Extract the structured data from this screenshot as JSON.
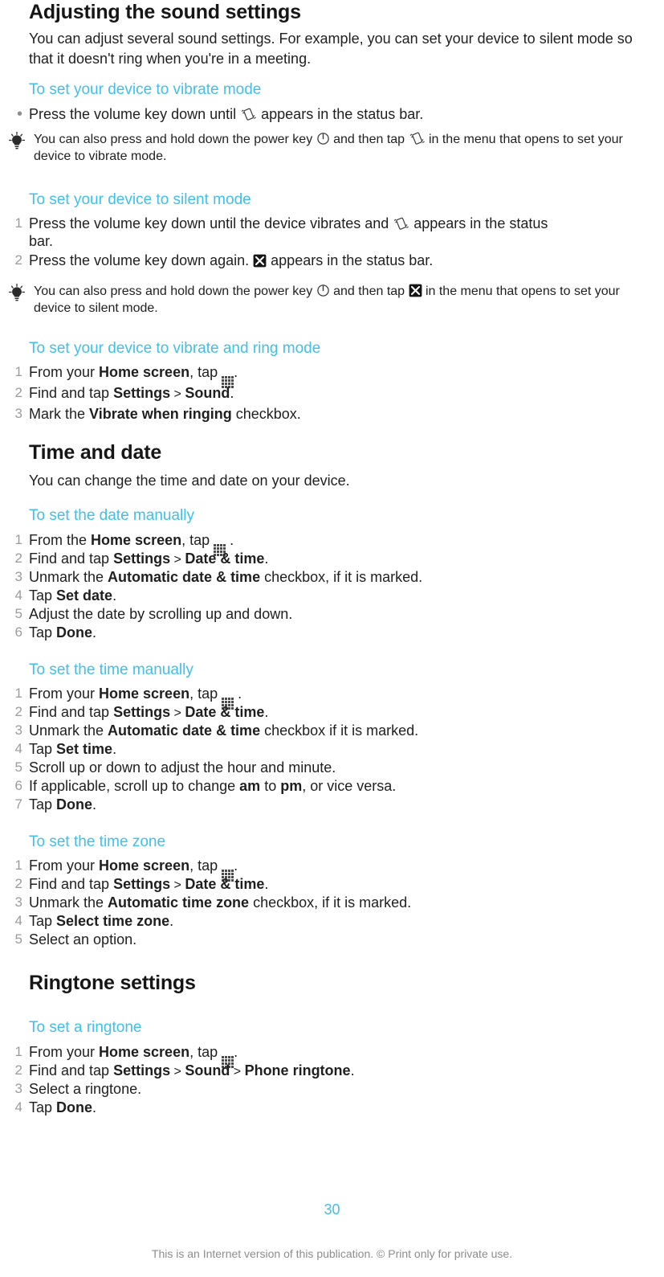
{
  "page": {
    "number": "30",
    "footer_note": "This is an Internet version of this publication. © Print only for private use."
  },
  "icons": {
    "vibrate": "vibrate-icon",
    "power": "power-key-icon",
    "silent": "silent-mode-icon",
    "apps": "app-grid-icon",
    "tip": "tip-lightbulb-icon"
  },
  "colors": {
    "accent": "#3ec0ea",
    "body": "#1f1f1f",
    "marker": "#9b9b9b",
    "footer": "#8d8d8d"
  },
  "sections": {
    "sound": {
      "title": "Adjusting the sound settings",
      "intro": "You can adjust several sound settings. For example, you can set your device to silent mode so that it doesn't ring when you're in a meeting."
    },
    "time_date": {
      "title": "Time and date",
      "intro": "You can change the time and date on your device."
    },
    "ringtone": {
      "title": "Ringtone settings"
    }
  },
  "procedures": {
    "vibrate_mode": {
      "title": "To set your device to vibrate mode",
      "bullet": {
        "before": "Press the volume key down until ",
        "after": " appears in the status bar."
      },
      "tip": {
        "p1": "You can also press and hold down the power key ",
        "p2": " and then tap ",
        "p3": " in the menu that opens to set your device to vibrate mode."
      }
    },
    "silent_mode": {
      "title": "To set your device to silent mode",
      "steps": [
        {
          "before": "Press the volume key down until the device vibrates and ",
          "after": " appears in the status bar."
        },
        {
          "before": "Press the volume key down again. ",
          "after": " appears in the status bar."
        }
      ],
      "tip": {
        "p1": "You can also press and hold down the power key ",
        "p2": " and then tap ",
        "p3": " in the menu that opens to set your device to silent mode."
      }
    },
    "vibrate_ring_mode": {
      "title": "To set your device to vibrate and ring mode",
      "steps": [
        {
          "pre": "From your ",
          "b1": "Home screen",
          "mid": ", tap ",
          "post": "."
        },
        {
          "pre": "Find and tap ",
          "b1": "Settings",
          "sep": " > ",
          "b2": "Sound",
          "post": "."
        },
        {
          "pre": "Mark the ",
          "b1": "Vibrate when ringing",
          "post": " checkbox."
        }
      ]
    },
    "date_manually": {
      "title": "To set the date manually",
      "steps": [
        {
          "pre": "From the ",
          "b1": "Home screen",
          "mid": ", tap ",
          "post": " ."
        },
        {
          "pre": "Find and tap ",
          "b1": "Settings",
          "sep": " > ",
          "b2": "Date & time",
          "post": "."
        },
        {
          "pre": "Unmark the ",
          "b1": "Automatic date & time",
          "post": " checkbox, if it is marked."
        },
        {
          "pre": "Tap ",
          "b1": "Set date",
          "post": "."
        },
        {
          "pre": "Adjust the date by scrolling up and down.",
          "post": ""
        },
        {
          "pre": "Tap ",
          "b1": "Done",
          "post": "."
        }
      ]
    },
    "time_manually": {
      "title": "To set the time manually",
      "steps": [
        {
          "pre": "From your ",
          "b1": "Home screen",
          "mid": ", tap ",
          "post": " ."
        },
        {
          "pre": "Find and tap ",
          "b1": "Settings",
          "sep": " > ",
          "b2": "Date & time",
          "post": "."
        },
        {
          "pre": "Unmark the ",
          "b1": "Automatic date & time",
          "post": " checkbox if it is marked."
        },
        {
          "pre": "Tap ",
          "b1": "Set time",
          "post": "."
        },
        {
          "pre": "Scroll up or down to adjust the hour and minute.",
          "post": ""
        },
        {
          "pre": "If applicable, scroll up to change ",
          "b1": "am",
          "mid2": " to ",
          "b2": "pm",
          "post": ", or vice versa."
        },
        {
          "pre": "Tap ",
          "b1": "Done",
          "post": "."
        }
      ]
    },
    "time_zone": {
      "title": "To set the time zone",
      "steps": [
        {
          "pre": "From your ",
          "b1": "Home screen",
          "mid": ", tap ",
          "post": "."
        },
        {
          "pre": "Find and tap ",
          "b1": "Settings",
          "sep": " > ",
          "b2": "Date & time",
          "post": "."
        },
        {
          "pre": "Unmark the ",
          "b1": "Automatic time zone",
          "post": " checkbox, if it is marked."
        },
        {
          "pre": "Tap ",
          "b1": "Select time zone",
          "post": "."
        },
        {
          "pre": "Select an option.",
          "post": ""
        }
      ]
    },
    "set_ringtone": {
      "title": "To set a ringtone",
      "steps": [
        {
          "pre": "From your ",
          "b1": "Home screen",
          "mid": ", tap ",
          "post": "."
        },
        {
          "pre": "Find and tap ",
          "b1": "Settings",
          "sep": " > ",
          "b2": "Sound",
          "sep2": " > ",
          "b3": "Phone ringtone",
          "post": "."
        },
        {
          "pre": "Select a ringtone.",
          "post": ""
        },
        {
          "pre": "Tap ",
          "b1": "Done",
          "post": "."
        }
      ]
    }
  },
  "markers": {
    "bullet": "•",
    "n1": "1",
    "n2": "2",
    "n3": "3",
    "n4": "4",
    "n5": "5",
    "n6": "6",
    "n7": "7"
  }
}
